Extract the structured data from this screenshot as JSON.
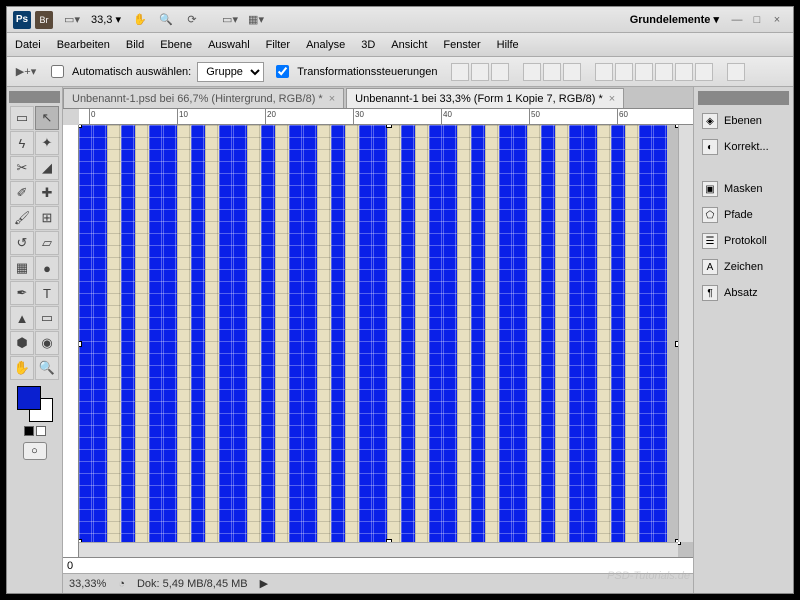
{
  "title": {
    "workspace": "Grundelemente",
    "zoom": "33,3"
  },
  "menu": {
    "items": [
      "Datei",
      "Bearbeiten",
      "Bild",
      "Ebene",
      "Auswahl",
      "Filter",
      "Analyse",
      "3D",
      "Ansicht",
      "Fenster",
      "Hilfe"
    ]
  },
  "options": {
    "autoSelect": "Automatisch auswählen:",
    "group": "Gruppe",
    "transform": "Transformationssteuerungen"
  },
  "tabs": [
    {
      "label": "Unbenannt-1.psd bei 66,7% (Hintergrund, RGB/8) *"
    },
    {
      "label": "Unbenannt-1 bei 33,3% (Form 1 Kopie 7, RGB/8) *"
    }
  ],
  "ruler": {
    "marks": [
      "0",
      "10",
      "20",
      "30",
      "40",
      "50",
      "60"
    ]
  },
  "panels": {
    "items": [
      "Ebenen",
      "Korrekt...",
      "Masken",
      "Pfade",
      "Protokoll",
      "Zeichen",
      "Absatz"
    ]
  },
  "status": {
    "zoom": "33,33%",
    "doc": "Dok: 5,49 MB/8,45 MB"
  },
  "colors": {
    "fg": "#0a20d0",
    "bg": "#ffffff"
  },
  "ruler_bottom": {
    "mark": "0"
  },
  "watermark": "PSD-Tutorials.de",
  "icons": {
    "ps": "Ps",
    "br": "Br",
    "dropdown": "▾",
    "hand": "✋",
    "zoom": "🔍",
    "rotate": "⟳",
    "screen": "▭",
    "arrange": "▦",
    "min": "—",
    "max": "□",
    "close": "×",
    "move": "↖",
    "circle": "○"
  }
}
